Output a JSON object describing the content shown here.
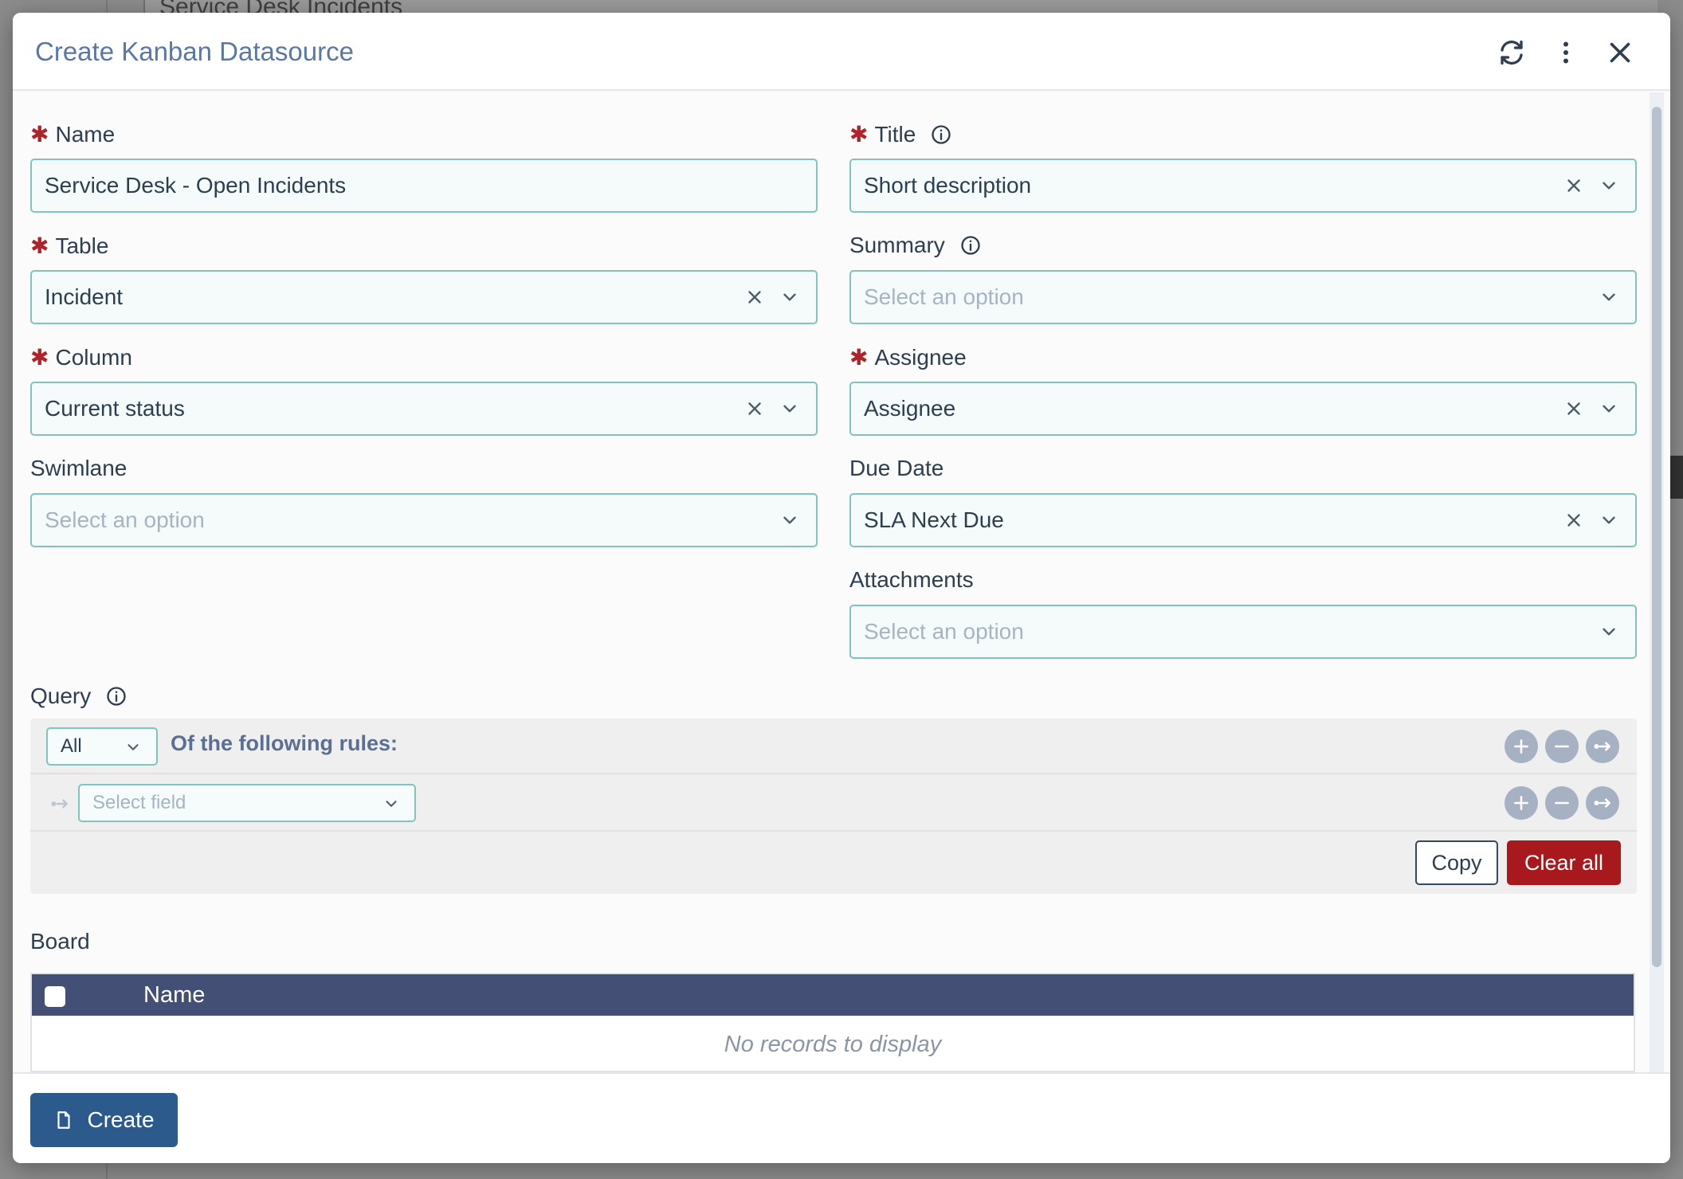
{
  "background": {
    "page_title": "Service Desk Incidents"
  },
  "dialog": {
    "title": "Create Kanban Datasource",
    "header_icons": [
      "refresh-icon",
      "more-vertical-icon",
      "close-icon"
    ]
  },
  "form": {
    "name": {
      "label": "Name",
      "required": true,
      "value": "Service Desk - Open Incidents"
    },
    "title": {
      "label": "Title",
      "required": true,
      "value": "Short description"
    },
    "table": {
      "label": "Table",
      "required": true,
      "value": "Incident"
    },
    "summary": {
      "label": "Summary",
      "required": false,
      "placeholder": "Select an option"
    },
    "column": {
      "label": "Column",
      "required": true,
      "value": "Current status"
    },
    "assignee": {
      "label": "Assignee",
      "required": true,
      "value": "Assignee"
    },
    "swimlane": {
      "label": "Swimlane",
      "required": false,
      "placeholder": "Select an option"
    },
    "due_date": {
      "label": "Due Date",
      "required": false,
      "value": "SLA Next Due"
    },
    "attachments": {
      "label": "Attachments",
      "required": false,
      "placeholder": "Select an option"
    },
    "required_mark": "✱"
  },
  "query": {
    "label": "Query",
    "combinator": "All",
    "rules_title": "Of the following rules:",
    "field_placeholder": "Select field",
    "copy_label": "Copy",
    "clear_label": "Clear all"
  },
  "board": {
    "label": "Board",
    "columns": [
      "Name"
    ],
    "empty_text": "No records to display"
  },
  "footer": {
    "create_label": "Create"
  },
  "colors": {
    "accent": "#2c5a8c",
    "danger": "#a7191c",
    "field_border": "#7fc4bf",
    "grid_header": "#434f74",
    "required": "#b0232a"
  }
}
